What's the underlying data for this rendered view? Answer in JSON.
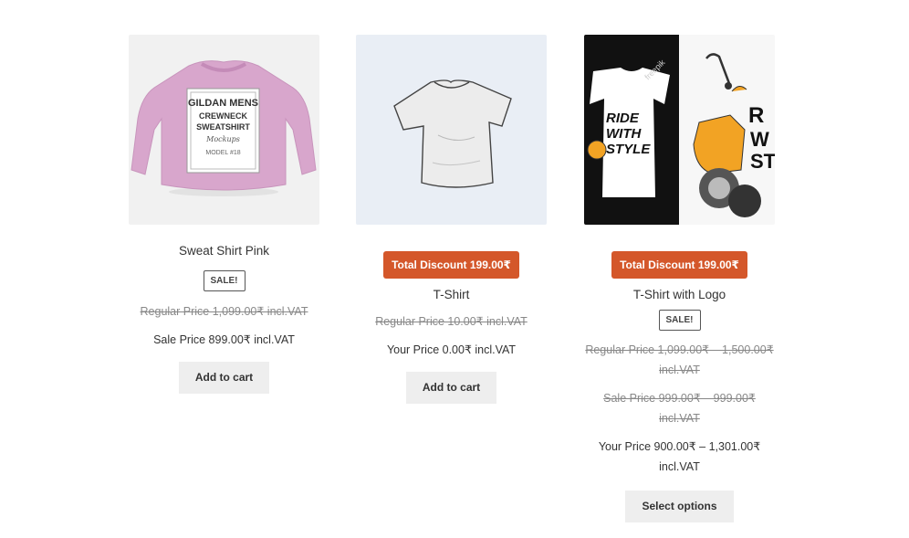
{
  "products": [
    {
      "name": "Sweat Shirt Pink",
      "badge": "SALE!",
      "regular_price": "Regular Price 1,099.00₹ incl.VAT",
      "sale_price": "Sale Price 899.00₹ incl.VAT",
      "button": "Add to cart",
      "image": {
        "icon": "pink-sweatshirt-image",
        "label_lines": [
          "GILDAN MENS",
          "CREWNECK",
          "SWEATSHIRT",
          "Mockups",
          "MODEL #18"
        ],
        "color": "#d8a6cc",
        "background": "#f1f1f1"
      }
    },
    {
      "name": "T-Shirt",
      "discount": "Total Discount 199.00₹",
      "regular_price": "Regular Price 10.00₹ incl.VAT",
      "your_price": "Your Price 0.00₹ incl.VAT",
      "button": "Add to cart",
      "image": {
        "icon": "white-tshirt-image",
        "background": "#e9eef5"
      }
    },
    {
      "name": "T-Shirt with Logo",
      "discount": "Total Discount 199.00₹",
      "badge": "SALE!",
      "regular_price_line1": "Regular Price 1,099.00₹ – 1,500.00₹",
      "regular_price_line2": "incl.VAT",
      "sale_price": "Sale Price 999.00₹ – 999.00₹ incl.VAT",
      "your_price_line1": "Your Price 900.00₹ – 1,301.00₹",
      "your_price_line2": "incl.VAT",
      "button": "Select options",
      "image": {
        "icon": "scooter-tshirt-image",
        "text_lines": [
          "RIDE",
          "WITH",
          "STYLE"
        ],
        "watermark": "freepik",
        "scooter_color": "#f2a324"
      }
    }
  ],
  "colors": {
    "discount_bg": "#d4572a",
    "button_bg": "#eeeeee"
  }
}
